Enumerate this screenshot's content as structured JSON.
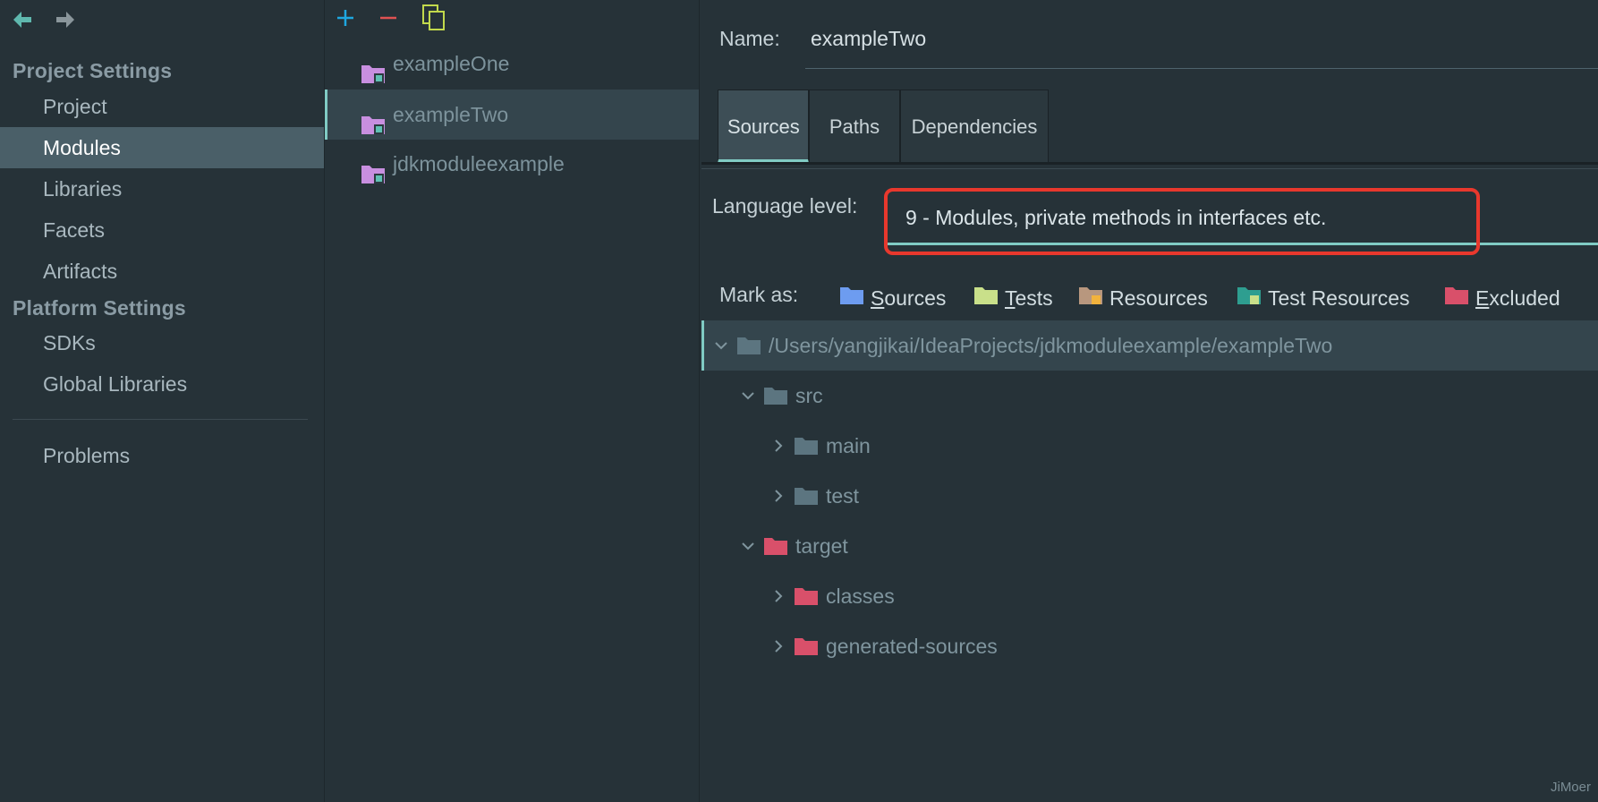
{
  "left": {
    "sections": [
      {
        "title": "Project Settings",
        "items": [
          "Project",
          "Modules",
          "Libraries",
          "Facets",
          "Artifacts"
        ]
      },
      {
        "title": "Platform Settings",
        "items": [
          "SDKs",
          "Global Libraries"
        ]
      }
    ],
    "problems": "Problems",
    "selected_item": "Modules"
  },
  "middle": {
    "modules": [
      "exampleOne",
      "exampleTwo",
      "jdkmoduleexample"
    ],
    "selected_module": "exampleTwo"
  },
  "right": {
    "name_label": "Name:",
    "name_value": "exampleTwo",
    "tabs": [
      "Sources",
      "Paths",
      "Dependencies"
    ],
    "active_tab": "Sources",
    "language_label": "Language level:",
    "language_value": "9 - Modules, private methods in interfaces etc.",
    "mark_as_label": "Mark as:",
    "mark_as": [
      {
        "pre": "",
        "u": "S",
        "rest": "ources",
        "color": "#6d9cf0"
      },
      {
        "pre": "",
        "u": "T",
        "rest": "ests",
        "color": "#c9e08a"
      },
      {
        "pre": "Resources",
        "u": "",
        "rest": "",
        "color": "#b8977e"
      },
      {
        "pre": "Test Resources",
        "u": "",
        "rest": "",
        "color": "#2e9e90"
      },
      {
        "pre": "",
        "u": "E",
        "rest": "xcluded",
        "color": "#d9506a"
      }
    ],
    "tree": [
      {
        "label": "/Users/yangjikai/IdeaProjects/jdkmoduleexample/exampleTwo",
        "expanded": true,
        "color": "#5c7580"
      },
      {
        "label": "src",
        "expanded": true,
        "color": "#5c7580"
      },
      {
        "label": "main",
        "expanded": false,
        "color": "#5c7580"
      },
      {
        "label": "test",
        "expanded": false,
        "color": "#5c7580"
      },
      {
        "label": "target",
        "expanded": true,
        "color": "#d9506a"
      },
      {
        "label": "classes",
        "expanded": false,
        "color": "#d9506a"
      },
      {
        "label": "generated-sources",
        "expanded": false,
        "color": "#d9506a"
      }
    ]
  },
  "colors": {
    "accent": "#80cbc4",
    "selection": "#4a5f68",
    "highlight": "#e8382d",
    "add": "#1ea7e0",
    "remove": "#e05252",
    "copy": "#c2d94c",
    "module_icon": "#c88fe0"
  },
  "watermark": "JiMoer"
}
